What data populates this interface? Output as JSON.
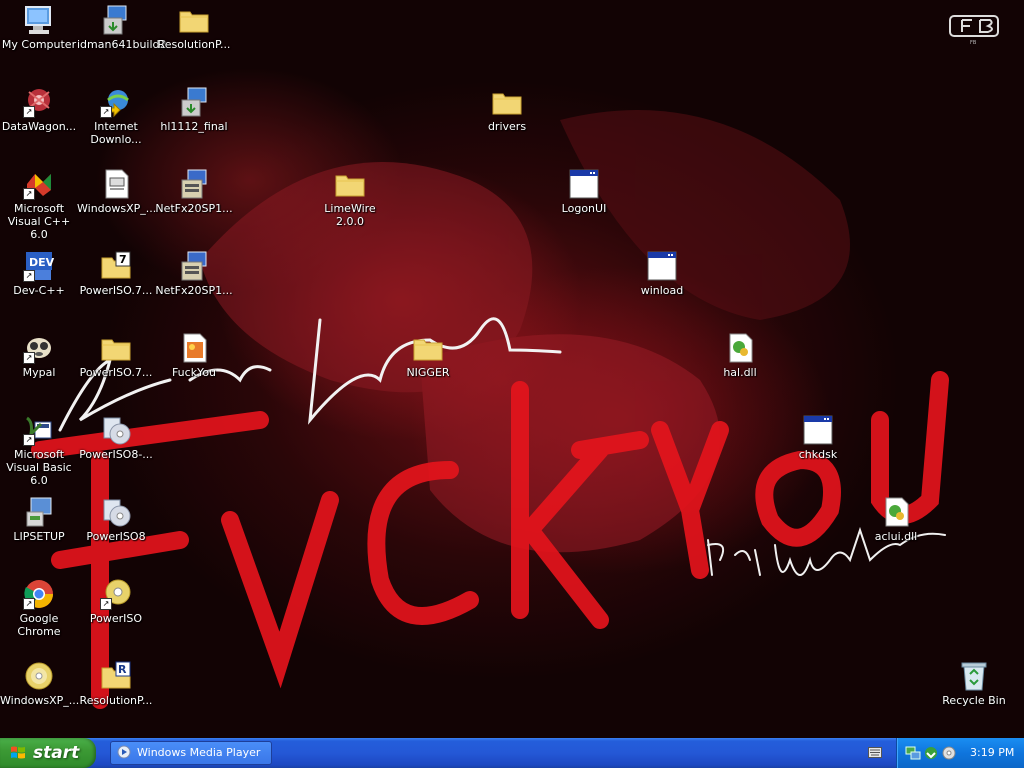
{
  "wallpaper": {
    "title_scribble": "Fvck You",
    "signature": "Kizz Daniel",
    "credit": "Prod by Young John",
    "brand_mark": "FB"
  },
  "desktop_icons": {
    "my_computer": "My Computer",
    "idman": "idman641build2",
    "resolutionp1": "ResolutionP...",
    "datawagon": "DataWagon...",
    "internet_download": "Internet Downlo...",
    "hl1112": "hl1112_final",
    "drivers": "drivers",
    "msvc": "Microsoft Visual C++ 6.0",
    "windowsxp1": "WindowsXP_...",
    "netfx1": "NetFx20SP1...",
    "limewire": "LimeWire 2.0.0",
    "logonui": "LogonUI",
    "devcpp": "Dev-C++",
    "poweriso7a": "PowerISO.7...",
    "netfx2": "NetFx20SP1...",
    "winload": "winload",
    "mypal": "Mypal",
    "poweriso7b": "PowerISO.7...",
    "fuckyou": "FuckYou",
    "nigger": "NIGGER",
    "haldll": "hal.dll",
    "msvb": "Microsoft Visual Basic 6.0",
    "poweriso8dash": "PowerISO8-...",
    "chkdsk": "chkdsk",
    "lipsetup": "LIPSETUP",
    "poweriso8": "PowerISO8",
    "acluidll": "aclui.dll",
    "chrome": "Google Chrome",
    "poweriso": "PowerISO",
    "windowsxp2": "WindowsXP_...",
    "resolutionp2": "ResolutionP...",
    "recycle": "Recycle Bin"
  },
  "taskbar": {
    "start_label": "start",
    "task_windows_media_player": "Windows Media Player",
    "clock": "3:19 PM"
  }
}
